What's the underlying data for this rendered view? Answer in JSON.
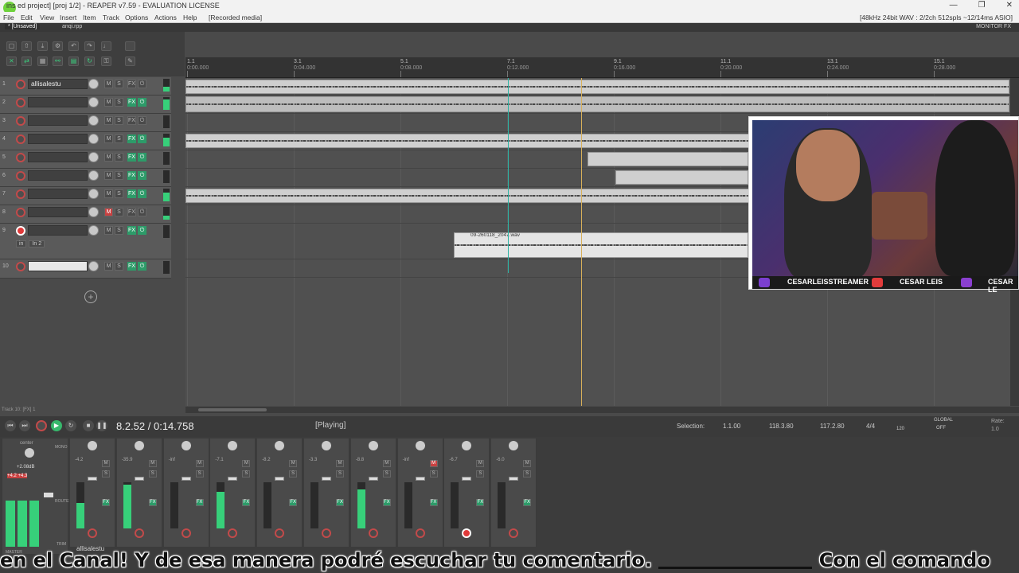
{
  "window": {
    "title": "ins ed project] [proj 1/2] - REAPER v7.59 - EVALUATION LICENSE",
    "controls": [
      "—",
      "❐",
      "✕"
    ]
  },
  "menu": {
    "items": [
      "File",
      "Edit",
      "View",
      "Insert",
      "Item",
      "Track",
      "Options",
      "Actions",
      "Help",
      "[Recorded media]"
    ],
    "status": "[48kHz 24bit WAV : 2/2ch 512spls ~12/14ms ASIO]"
  },
  "tabs": {
    "items": [
      "* [Unsaved]",
      "anqi.rpp"
    ],
    "monitor_fx": "MONITOR FX"
  },
  "ruler": {
    "marks": [
      {
        "bar": "1.1",
        "time": "0:00.000"
      },
      {
        "bar": "3.1",
        "time": "0:04.000"
      },
      {
        "bar": "5.1",
        "time": "0:08.000"
      },
      {
        "bar": "7.1",
        "time": "0:12.000"
      },
      {
        "bar": "9.1",
        "time": "0:16.000"
      },
      {
        "bar": "11.1",
        "time": "0:20.000"
      },
      {
        "bar": "13.1",
        "time": "0:24.000"
      },
      {
        "bar": "15.1",
        "time": "0:28.000"
      }
    ]
  },
  "tracks": [
    {
      "num": "1",
      "name": "allisalestu",
      "muted": false,
      "fx_on": false,
      "io_on": false,
      "meter": 0.4
    },
    {
      "num": "2",
      "name": "",
      "muted": false,
      "fx_on": true,
      "io_on": true,
      "meter": 0.8
    },
    {
      "num": "3",
      "name": "",
      "muted": false,
      "fx_on": false,
      "io_on": false,
      "meter": 0
    },
    {
      "num": "4",
      "name": "",
      "muted": false,
      "fx_on": true,
      "io_on": true,
      "meter": 0.7
    },
    {
      "num": "5",
      "name": "",
      "muted": false,
      "fx_on": true,
      "io_on": true,
      "meter": 0
    },
    {
      "num": "6",
      "name": "",
      "muted": false,
      "fx_on": true,
      "io_on": true,
      "meter": 0
    },
    {
      "num": "7",
      "name": "",
      "muted": false,
      "fx_on": true,
      "io_on": true,
      "meter": 0.7
    },
    {
      "num": "8",
      "name": "",
      "muted": true,
      "fx_on": false,
      "io_on": false,
      "meter": 0.3
    },
    {
      "num": "9",
      "name": "",
      "muted": false,
      "fx_on": true,
      "io_on": true,
      "meter": 0,
      "armed": true,
      "input": "in",
      "input_channel": "In 2"
    },
    {
      "num": "10",
      "name": "",
      "muted": false,
      "fx_on": true,
      "io_on": true,
      "meter": 0
    }
  ],
  "track_buttons": {
    "mute": "M",
    "solo": "S",
    "fx": "FX"
  },
  "recording_clip": {
    "name": "09-260118_2047.wav"
  },
  "bottom_status": "Track 10: [FX] 1",
  "transport": {
    "time": "8.2.52 / 0:14.758",
    "state": "[Playing]",
    "selection_label": "Selection:",
    "selection_start": "1.1.00",
    "selection_end": "118.3.80",
    "selection_length": "117.2.80",
    "time_signature": "4/4",
    "bpm": "120",
    "rate_label": "Rate:",
    "rate_value": "1.0",
    "global": "GLOBAL",
    "global_off": "OFF"
  },
  "mixer": {
    "master_label": "MASTER",
    "master_db": "+2.08dB",
    "master_peak": "+4.2 +4.3",
    "center": "center",
    "mono": "MONO",
    "route": "ROUTE",
    "trim": "TRIM",
    "strips": [
      {
        "db": "-4.2",
        "meter": 0.55,
        "muted": false,
        "armed": false
      },
      {
        "db": "-35.9",
        "meter": 0.95,
        "muted": false,
        "armed": false
      },
      {
        "db": "-inf",
        "meter": 0,
        "muted": false,
        "armed": false
      },
      {
        "db": "-7.1",
        "meter": 0.8,
        "muted": false,
        "armed": false
      },
      {
        "db": "-8.2",
        "meter": 0,
        "muted": false,
        "armed": false
      },
      {
        "db": "-3.3",
        "meter": 0,
        "muted": false,
        "armed": false
      },
      {
        "db": "-8.8",
        "meter": 0.85,
        "muted": false,
        "armed": false
      },
      {
        "db": "-inf",
        "meter": 0,
        "muted": true,
        "armed": false
      },
      {
        "db": "-6.7",
        "meter": 0,
        "muted": false,
        "armed": true
      },
      {
        "db": "-6.0",
        "meter": 0,
        "muted": false,
        "armed": false
      }
    ],
    "first_strip_name": "allisalestu"
  },
  "webcam": {
    "handles": [
      "CESARLEISSTREAMER",
      "CESAR LEIS",
      "CESAR LE"
    ]
  },
  "subtitle": {
    "part1": "en el  Canal!   Y de esa manera podré escuchar tu comentario. ",
    "part2": " Con el comando "
  },
  "colors": {
    "accent_green": "#2d9b69",
    "meter_green": "#37d07a",
    "record_red": "#c24a4a",
    "edit_cursor": "#2eb3a4",
    "play_cursor": "#d8b05a"
  }
}
